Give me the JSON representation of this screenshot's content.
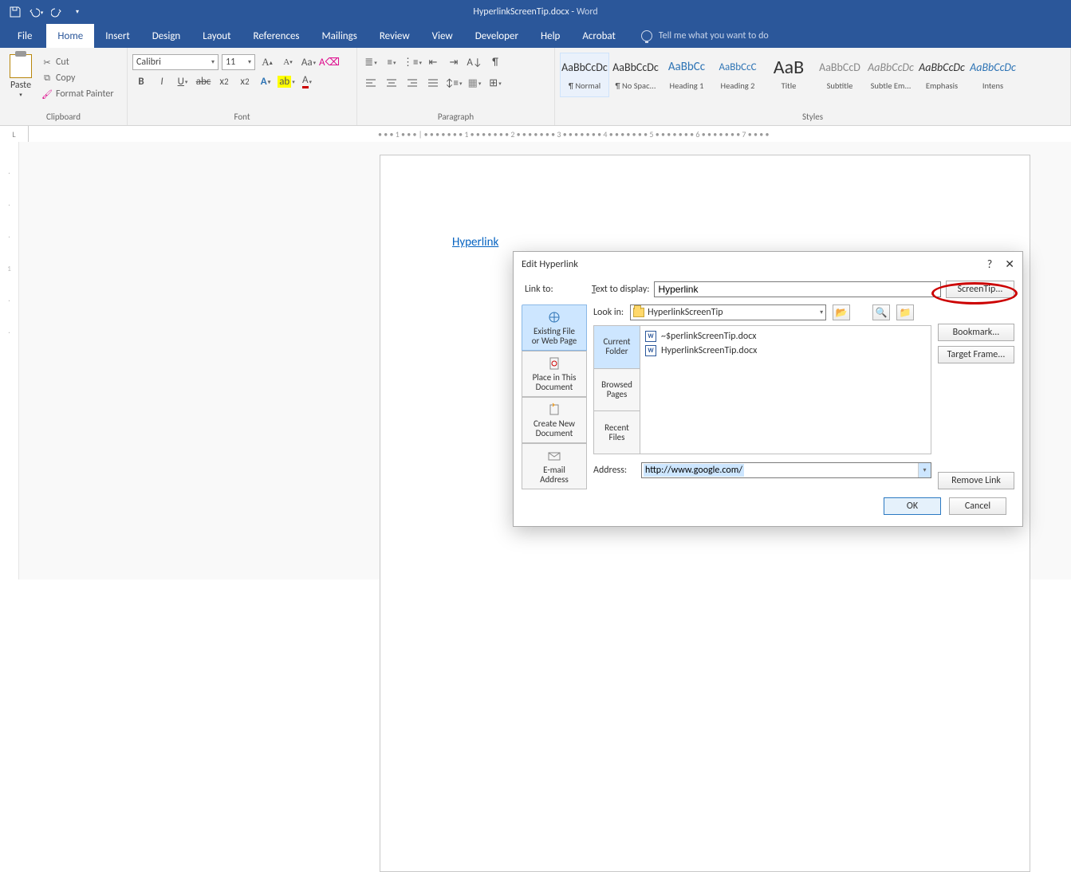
{
  "title": {
    "doc": "HyperlinkScreenTip.docx",
    "sep": " - ",
    "app": "Word"
  },
  "tabs": {
    "file": "File",
    "home": "Home",
    "insert": "Insert",
    "design": "Design",
    "layout": "Layout",
    "references": "References",
    "mailings": "Mailings",
    "review": "Review",
    "view": "View",
    "developer": "Developer",
    "help": "Help",
    "acrobat": "Acrobat",
    "tellme": "Tell me what you want to do"
  },
  "clipboard": {
    "paste": "Paste",
    "cut": "Cut",
    "copy": "Copy",
    "formatpainter": "Format Painter",
    "group": "Clipboard"
  },
  "font": {
    "name": "Calibri",
    "size": "11",
    "group": "Font"
  },
  "paragraph": {
    "group": "Paragraph"
  },
  "styles": {
    "group": "Styles",
    "items": [
      {
        "prev": "AaBbCcDc",
        "name": "¶ Normal"
      },
      {
        "prev": "AaBbCcDc",
        "name": "¶ No Spac..."
      },
      {
        "prev": "AaBbCc",
        "name": "Heading 1"
      },
      {
        "prev": "AaBbCcC",
        "name": "Heading 2"
      },
      {
        "prev": "AaB",
        "name": "Title"
      },
      {
        "prev": "AaBbCcD",
        "name": "Subtitle"
      },
      {
        "prev": "AaBbCcDc",
        "name": "Subtle Em..."
      },
      {
        "prev": "AaBbCcDc",
        "name": "Emphasis"
      },
      {
        "prev": "AaBbCcDc",
        "name": "Intens"
      }
    ]
  },
  "document": {
    "link_text": "Hyperlink"
  },
  "ruler": {
    "h": "• • • 1 • • • | • • • • • • • 1 • • • • • • • 2 • • • • • • • 3 • • • • • • • 4 • • • • • • • 5 • • • • • • • 6 • • • • • • • 7 • • • •"
  },
  "dialog": {
    "title": "Edit Hyperlink",
    "linkto_label": "Link to:",
    "text_to_display_label": "Text to display:",
    "text_to_display_value": "Hyperlink",
    "screentip": "ScreenTip...",
    "lookin_label": "Look in:",
    "lookin_value": "HyperlinkScreenTip",
    "linkto": {
      "existing": "Existing File\nor Web Page",
      "place": "Place in This\nDocument",
      "create": "Create New\nDocument",
      "email": "E-mail\nAddress"
    },
    "browse_tabs": {
      "current": "Current\nFolder",
      "browsed": "Browsed\nPages",
      "recent": "Recent\nFiles"
    },
    "files": [
      "~$perlinkScreenTip.docx",
      "HyperlinkScreenTip.docx"
    ],
    "address_label": "Address:",
    "address_value": "http://www.google.com/",
    "bookmark": "Bookmark...",
    "target_frame": "Target Frame...",
    "remove_link": "Remove Link",
    "ok": "OK",
    "cancel": "Cancel"
  }
}
